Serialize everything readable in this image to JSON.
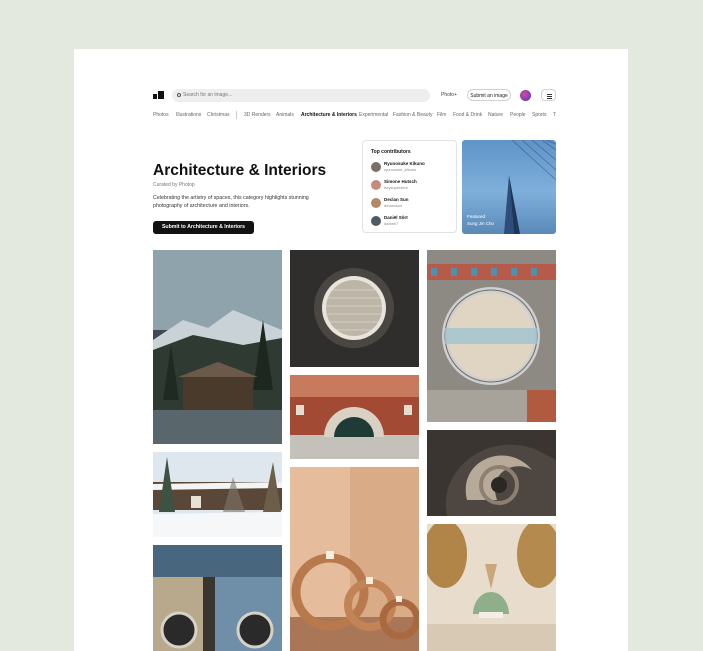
{
  "header": {
    "search_placeholder": "Search for an image...",
    "photo_plus": "Photo+",
    "submit_label": "Submit an image"
  },
  "nav": {
    "items": [
      "Photos",
      "Illustrations",
      "Christmas",
      "3D Renders",
      "Animals",
      "Architecture & Interiors",
      "Experimental",
      "Fashion & Beauty",
      "Film",
      "Food & Drink",
      "Nature",
      "People",
      "Sports",
      "T"
    ],
    "active_index": 5
  },
  "hero": {
    "title": "Architecture & Interiors",
    "curated": "Curated by Photop",
    "description": "Celebrating the artistry of spaces, this category highlights stunning photography of architecture and interiors.",
    "cta_label": "Submit to Architecture & Interiors"
  },
  "contributors": {
    "heading": "Top contributors",
    "people": [
      {
        "name": "Ryunosuke Kikuno",
        "handle": "ryunosuke_kikuno",
        "color": "#7a6f63"
      },
      {
        "name": "Simone Hutsch",
        "handle": "heysupersimi",
        "color": "#c78a7d"
      },
      {
        "name": "Declan Sun",
        "handle": "declansun",
        "color": "#b4876b"
      },
      {
        "name": "Daniël Sôrt",
        "handle": "danielr7",
        "color": "#4f5a63"
      }
    ]
  },
  "featured": {
    "label": "Featured",
    "author": "Sung Jin Cho"
  },
  "colors": {
    "background": "#e4e9df",
    "page": "#ffffff",
    "primary_button": "#111111"
  }
}
